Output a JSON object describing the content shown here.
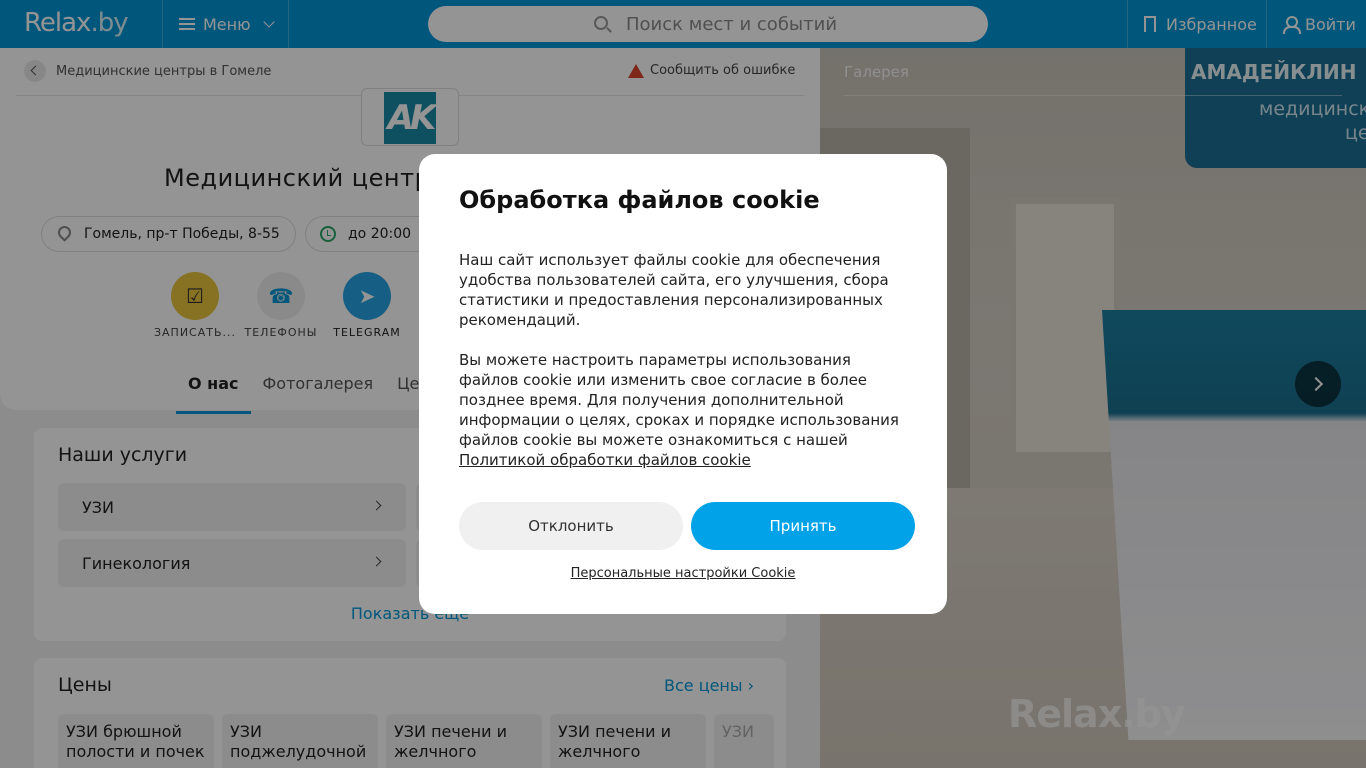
{
  "header": {
    "logo": "Relax",
    "logo_suffix": ".by",
    "menu_label": "Меню",
    "search_placeholder": "Поиск мест и событий",
    "favorites_label": "Избранное",
    "login_label": "Войти"
  },
  "breadcrumb": {
    "label": "Медицинские центры в Гомеле"
  },
  "report_label": "Сообщить об ошибке",
  "company": {
    "logo_text": "AK",
    "title": "Медицинский центр",
    "address": "Гомель, пр-т Победы, 8-55",
    "hours": "до 20:00"
  },
  "actions": [
    {
      "label": "ЗАПИСАТЬ...",
      "icon": "calendar-check-icon",
      "color": "#e9c33b"
    },
    {
      "label": "ТЕЛЕФОНЫ",
      "icon": "phone-icon",
      "color": "#eeeeee"
    },
    {
      "label": "TELEGRAM",
      "icon": "telegram-icon",
      "color": "#28a3e3"
    }
  ],
  "tabs": [
    {
      "label": "О нас",
      "active": true
    },
    {
      "label": "Фотогалерея",
      "active": false
    },
    {
      "label": "Цен",
      "active": false
    }
  ],
  "services": {
    "title": "Наши услуги",
    "items": [
      "УЗИ",
      "Гинекология"
    ],
    "more_label": "Показать еще"
  },
  "prices": {
    "title": "Цены",
    "all_label": "Все цены",
    "items": [
      "УЗИ брюшной полости и почек",
      "УЗИ поджелудочной",
      "УЗИ печени и желчного пузыря",
      "УЗИ печени и желчного пузыря",
      "УЗИ"
    ]
  },
  "gallery": {
    "title": "Галерея",
    "sign_line1": "АМАДЕЙКЛИН",
    "sign_line2": "медицинск",
    "sign_line3": "цен",
    "watermark": "Relax.by"
  },
  "cookie": {
    "title": "Обработка файлов cookie",
    "para1": "Наш сайт использует файлы cookie для обеспечения удобства пользователей сайта, его улучшения, сбора статистики и предоставления персонализированных рекомендаций.",
    "para2": "Вы можете настроить параметры использования файлов cookie или изменить свое согласие в более позднее время. Для получения дополнительной информации о целях, сроках и порядке использования файлов cookie вы можете ознакомиться с нашей",
    "policy_link": "Политикой обработки файлов cookie",
    "decline_label": "Отклонить",
    "accept_label": "Принять",
    "personal_settings_label": "Персональные настройки Cookie"
  },
  "colors": {
    "brand": "#0196d5",
    "accept": "#01a2e8"
  }
}
